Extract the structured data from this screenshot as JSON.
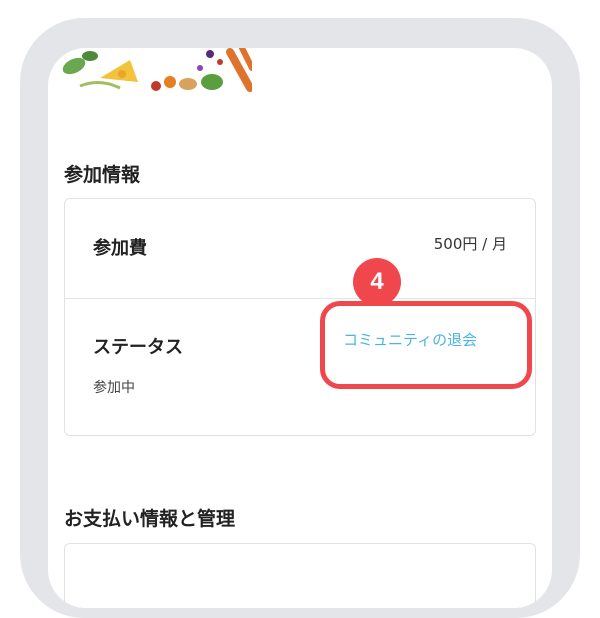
{
  "hero": {
    "image": "vegetables-illustration"
  },
  "participation": {
    "section_title": "参加情報",
    "fee_label": "参加費",
    "fee_value": "500円 / 月",
    "status_label": "ステータス",
    "status_value": "参加中",
    "leave_link": "コミュニティの退会"
  },
  "payment": {
    "section_title": "お支払い情報と管理"
  },
  "annotation": {
    "step_number": "4",
    "color": "#f0474d"
  },
  "colors": {
    "link": "#4ab4e6",
    "frame": "#e4e5e8"
  }
}
